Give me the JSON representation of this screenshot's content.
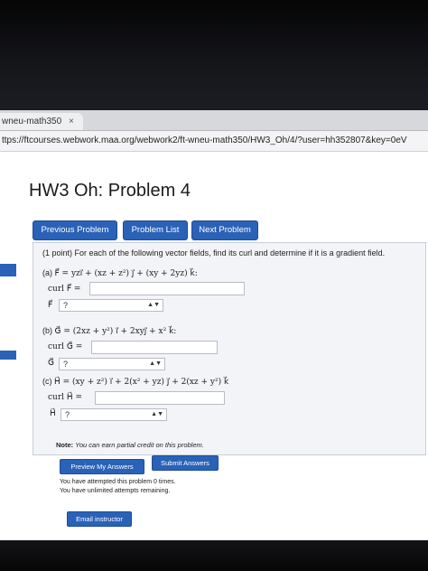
{
  "browser": {
    "tab_title": "wneu-math350",
    "tab_close": "×",
    "url": "ttps://ftcourses.webwork.maa.org/webwork2/ft-wneu-math350/HW3_Oh/4/?user=hh352807&key=0eV"
  },
  "page": {
    "title": "HW3 Oh: Problem 4",
    "nav": {
      "previous": "Previous Problem",
      "list": "Problem List",
      "next": "Next Problem"
    },
    "problem": {
      "intro": "(1 point) For each of the following vector fields, find its curl and determine if it is a gradient field.",
      "parts": [
        {
          "label": "(a)",
          "field": "F⃗ = yzı⃗ + (xz + z²) ȷ⃗ + (xy + 2yz) k⃗:",
          "curl_label": "curl F⃗ =",
          "select_label": "F⃗",
          "select_value": "?"
        },
        {
          "label": "(b)",
          "field": "G⃗ = (2xz + y²) ı⃗ + 2xyȷ⃗ + x² k⃗:",
          "curl_label": "curl G⃗ =",
          "select_label": "G⃗",
          "select_value": "?"
        },
        {
          "label": "(c)",
          "field": "H⃗ = (xy + z²) ı⃗ + 2(x² + yz) ȷ⃗ + 2(xz + y²) k⃗",
          "curl_label": "curl H⃗ =",
          "select_label": "H⃗",
          "select_value": "?"
        }
      ]
    },
    "note_label": "Note:",
    "note_text": "You can earn partial credit on this problem.",
    "buttons": {
      "preview": "Preview My Answers",
      "submit": "Submit Answers",
      "email": "Email instructor"
    },
    "attempts_line1": "You have attempted this problem 0 times.",
    "attempts_line2": "You have unlimited attempts remaining."
  },
  "colors": {
    "button_blue": "#2a62b8",
    "problem_bg": "#f3f4f7"
  }
}
